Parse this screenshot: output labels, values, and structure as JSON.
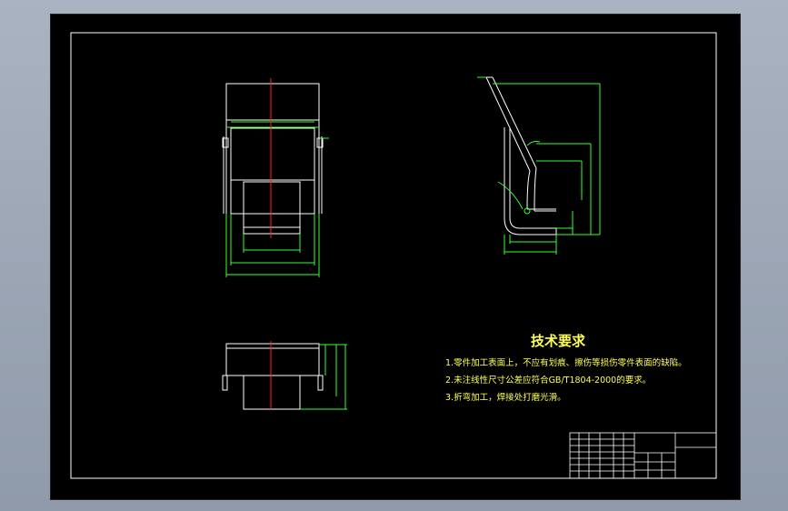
{
  "drawing": {
    "tech_requirements": {
      "title": "技术要求",
      "items": [
        "1.零件加工表面上，不应有划痕、擦伤等损伤零件表面的缺陷。",
        "2.未注线性尺寸公差应符合GB/T1804-2000的要求。",
        "3.折弯加工，焊接处打磨光滑。"
      ]
    },
    "colors": {
      "background": "#000000",
      "frame": "#ffffff",
      "outline": "#ffffff",
      "dimension": "#33ff33",
      "centerline": "#ff2222",
      "text": "#ffff55"
    }
  }
}
